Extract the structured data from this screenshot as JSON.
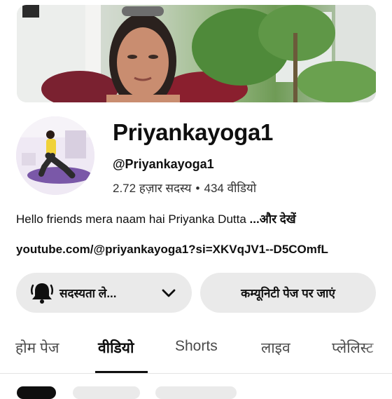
{
  "channel": {
    "name": "Priyankayoga1",
    "handle": "@Priyankayoga1",
    "subscribers": "2.72 हज़ार सदस्य",
    "separator": "•",
    "videos": "434 वीडियो",
    "description": "Hello friends mera naam hai Priyanka Dutta ",
    "more_label": "...और देखें",
    "link": "youtube.com/@priyankayoga1?si=XKVqJV1--D5COmfL"
  },
  "actions": {
    "subscribe_label": "सदस्यता ले...",
    "community_label": "कम्यूनिटी पेज पर जाएं"
  },
  "tabs": [
    {
      "label": "होम पेज",
      "active": false
    },
    {
      "label": "वीडियो",
      "active": true
    },
    {
      "label": "Shorts",
      "active": false
    },
    {
      "label": "लाइव",
      "active": false
    },
    {
      "label": "प्लेलिस्ट",
      "active": false
    }
  ],
  "icons": {
    "subscribe": "bell-icon",
    "dropdown": "chevron-down-icon"
  }
}
